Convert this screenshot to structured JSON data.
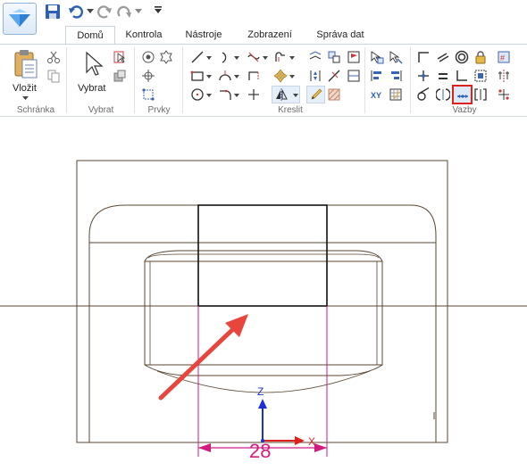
{
  "tabs": [
    {
      "label": "Domů"
    },
    {
      "label": "Kontrola"
    },
    {
      "label": "Nástroje"
    },
    {
      "label": "Zobrazení"
    },
    {
      "label": "Správa dat"
    }
  ],
  "ribbon": {
    "clipboard": {
      "paste_label": "Vložit",
      "group": "Schránka"
    },
    "select": {
      "select_label": "Vybrat",
      "group": "Vybrat"
    },
    "features": {
      "group": "Prvky"
    },
    "draw": {
      "group": "Kreslit"
    },
    "relations": {
      "group": "Vazby"
    }
  },
  "drawing": {
    "dimension_value": "28",
    "axis_z": "Z",
    "axis_x": "X"
  },
  "colors": {
    "sketch_line": "#5a4632",
    "dimension": "#d41a7f",
    "arrow": "#e8463c",
    "axis_z": "#1c2fd6",
    "axis_x": "#e0201c",
    "highlight_box": "#e0201c"
  }
}
